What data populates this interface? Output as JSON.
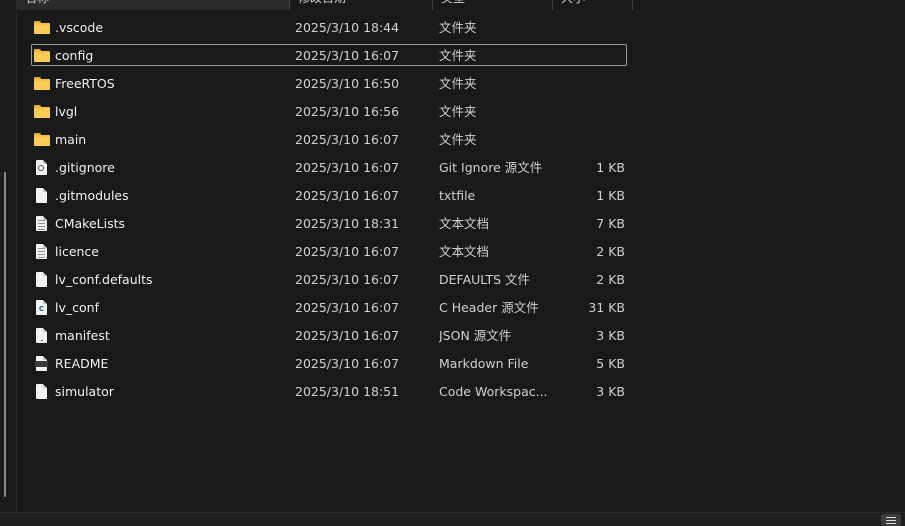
{
  "columns": {
    "name": "名称",
    "date": "修改日期",
    "type": "类型",
    "size": "大小"
  },
  "files": [
    {
      "name": ".vscode",
      "date": "2025/3/10 18:44",
      "type": "文件夹",
      "size": "",
      "icon": "folder-icon"
    },
    {
      "name": "config",
      "date": "2025/3/10 16:07",
      "type": "文件夹",
      "size": "",
      "icon": "folder-icon",
      "selected": true
    },
    {
      "name": "FreeRTOS",
      "date": "2025/3/10 16:50",
      "type": "文件夹",
      "size": "",
      "icon": "folder-icon"
    },
    {
      "name": "lvgl",
      "date": "2025/3/10 16:56",
      "type": "文件夹",
      "size": "",
      "icon": "folder-icon"
    },
    {
      "name": "main",
      "date": "2025/3/10 16:07",
      "type": "文件夹",
      "size": "",
      "icon": "folder-icon"
    },
    {
      "name": ".gitignore",
      "date": "2025/3/10 16:07",
      "type": "Git Ignore 源文件",
      "size": "1 KB",
      "icon": "gitignore-file-icon"
    },
    {
      "name": ".gitmodules",
      "date": "2025/3/10 16:07",
      "type": "txtfile",
      "size": "1 KB",
      "icon": "generic-file-icon"
    },
    {
      "name": "CMakeLists",
      "date": "2025/3/10 18:31",
      "type": "文本文档",
      "size": "7 KB",
      "icon": "text-file-icon"
    },
    {
      "name": "licence",
      "date": "2025/3/10 16:07",
      "type": "文本文档",
      "size": "2 KB",
      "icon": "text-file-icon"
    },
    {
      "name": "lv_conf.defaults",
      "date": "2025/3/10 16:07",
      "type": "DEFAULTS 文件",
      "size": "2 KB",
      "icon": "generic-file-icon"
    },
    {
      "name": "lv_conf",
      "date": "2025/3/10 16:07",
      "type": "C Header 源文件",
      "size": "31 KB",
      "icon": "c-header-file-icon"
    },
    {
      "name": "manifest",
      "date": "2025/3/10 16:07",
      "type": "JSON 源文件",
      "size": "3 KB",
      "icon": "json-file-icon"
    },
    {
      "name": "README",
      "date": "2025/3/10 16:07",
      "type": "Markdown File",
      "size": "5 KB",
      "icon": "markdown-file-icon"
    },
    {
      "name": "simulator",
      "date": "2025/3/10 18:51",
      "type": "Code Workspac...",
      "size": "3 KB",
      "icon": "workspace-file-icon"
    }
  ],
  "status_bar": {
    "view_toggle_icon": "details-view-icon"
  },
  "colors": {
    "background": "#191919",
    "folder": "#f4c148",
    "selection_outline": "#9a9a9a"
  }
}
